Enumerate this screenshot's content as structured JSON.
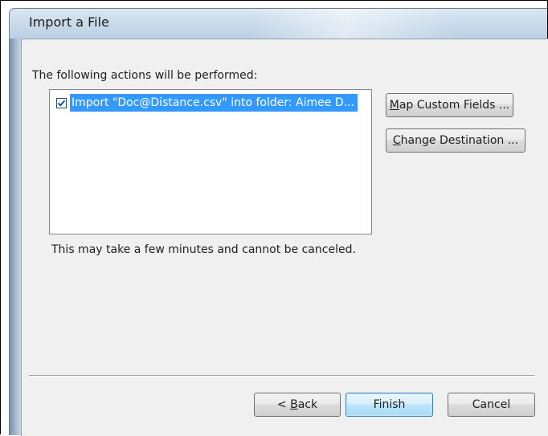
{
  "dialog": {
    "title": "Import a File",
    "instructions": "The following actions will be performed:",
    "actions": [
      {
        "checked": true,
        "label": "Import \"Doc@Distance.csv\" into folder: Aimee D..."
      }
    ],
    "side_buttons": {
      "map_custom_fields": {
        "accel": "M",
        "rest": "ap Custom Fields ..."
      },
      "change_destination": {
        "accel": "C",
        "rest": "hange Destination ..."
      }
    },
    "note": "This may take a few minutes and cannot be canceled.",
    "footer_buttons": {
      "back": {
        "prefix": "< ",
        "accel": "B",
        "rest": "ack"
      },
      "finish": "Finish",
      "cancel": "Cancel"
    }
  },
  "icons": {
    "checkbox": "check-icon"
  },
  "colors": {
    "selection": "#3399ff",
    "dialog_bg": "#f0f0f0",
    "title_bar": "#cadbeb"
  }
}
